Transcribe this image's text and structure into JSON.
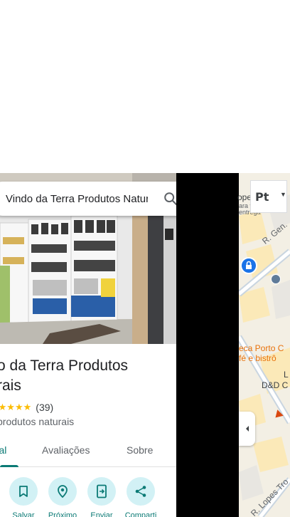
{
  "search": {
    "value": "Vindo da Terra Produtos Naturais"
  },
  "place": {
    "title": "o da Terra Produtos\nrais",
    "stars": "★★★★★",
    "review_count": "(39)",
    "category": "produtos naturais"
  },
  "tabs": [
    {
      "label": "eral"
    },
    {
      "label": "Avaliações"
    },
    {
      "label": "Sobre"
    }
  ],
  "actions": [
    {
      "label": "Salvar",
      "icon": "bookmark-icon"
    },
    {
      "label": "Próximo",
      "icon": "nearby-icon"
    },
    {
      "label": "Enviar",
      "icon": "send-to-phone-icon"
    },
    {
      "label": "Comparti",
      "icon": "share-icon"
    }
  ],
  "map": {
    "lang_button": "Pt",
    "labels": {
      "street_gen": "R. Gen.",
      "lope": "ope",
      "partial_1": "ara v",
      "partial_2": "entrega",
      "cafe_1": "eca Porto C",
      "cafe_2": "fé e bistrô",
      "dd": "D&D C",
      "l": "L",
      "lopes": "R. Lopes Tro"
    }
  },
  "colors": {
    "accent": "#0b7a75",
    "action_bg": "#d2f1f5",
    "star": "#fbbc04",
    "map_poi_orange": "#e8710a"
  }
}
